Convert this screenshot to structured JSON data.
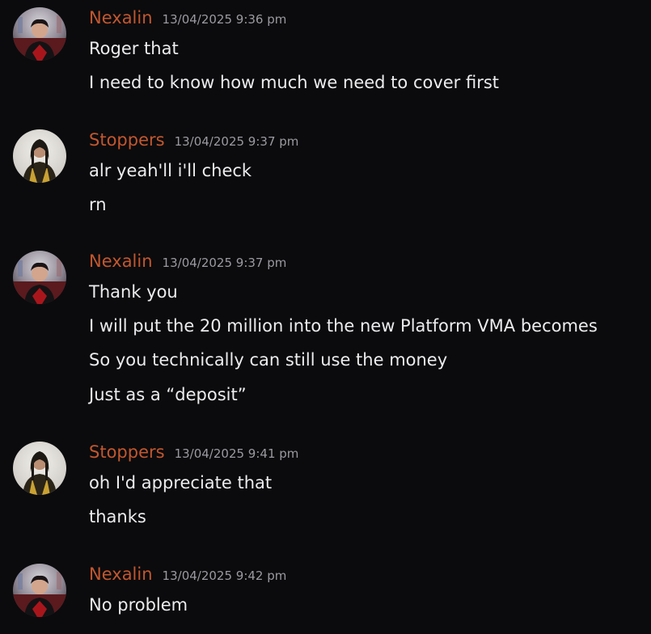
{
  "colors": {
    "background": "#0b0b0d",
    "username": "#c2572f",
    "timestamp": "#9a9aa0",
    "text": "#ececee"
  },
  "messages": [
    {
      "author": "Nexalin",
      "avatar_icon": "nexalin-avatar",
      "timestamp": "13/04/2025 9:36 pm",
      "lines": [
        "Roger that",
        "I need to know how much we need to cover first"
      ]
    },
    {
      "author": "Stoppers",
      "avatar_icon": "stoppers-avatar",
      "timestamp": "13/04/2025 9:37 pm",
      "lines": [
        "alr yeah'll i'll check",
        "rn"
      ]
    },
    {
      "author": "Nexalin",
      "avatar_icon": "nexalin-avatar",
      "timestamp": "13/04/2025 9:37 pm",
      "lines": [
        "Thank you",
        "I will put the 20 million into the new Platform VMA becomes",
        "So you technically can still use the money",
        "Just as a “deposit”"
      ]
    },
    {
      "author": "Stoppers",
      "avatar_icon": "stoppers-avatar",
      "timestamp": "13/04/2025 9:41 pm",
      "lines": [
        "oh I'd appreciate that",
        "thanks"
      ]
    },
    {
      "author": "Nexalin",
      "avatar_icon": "nexalin-avatar",
      "timestamp": "13/04/2025 9:42 pm",
      "lines": [
        "No problem"
      ]
    }
  ]
}
